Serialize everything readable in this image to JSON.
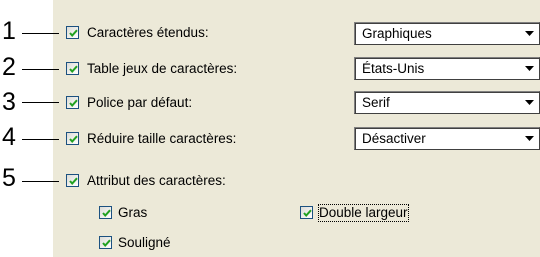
{
  "callouts": [
    "1",
    "2",
    "3",
    "4",
    "5"
  ],
  "settings": [
    {
      "label": "Caractères étendus:",
      "checked": true,
      "value": "Graphiques"
    },
    {
      "label": "Table jeux de caractères:",
      "checked": true,
      "value": "États-Unis"
    },
    {
      "label": "Police par défaut:",
      "checked": true,
      "value": "Serif"
    },
    {
      "label": "Réduire taille caractères:",
      "checked": true,
      "value": "Désactiver"
    },
    {
      "label": "Attribut des caractères:",
      "checked": true
    }
  ],
  "attributes": {
    "bold": {
      "label": "Gras",
      "checked": true
    },
    "double_width": {
      "label": "Double largeur",
      "checked": true
    },
    "underline": {
      "label": "Souligné",
      "checked": true
    }
  },
  "icons": {
    "check": "checkmark-icon",
    "dropdown": "chevron-down-icon"
  },
  "colors": {
    "panel_background": "#ece9d8",
    "checkbox_border": "#1c5180",
    "checkmark": "#21a121"
  }
}
